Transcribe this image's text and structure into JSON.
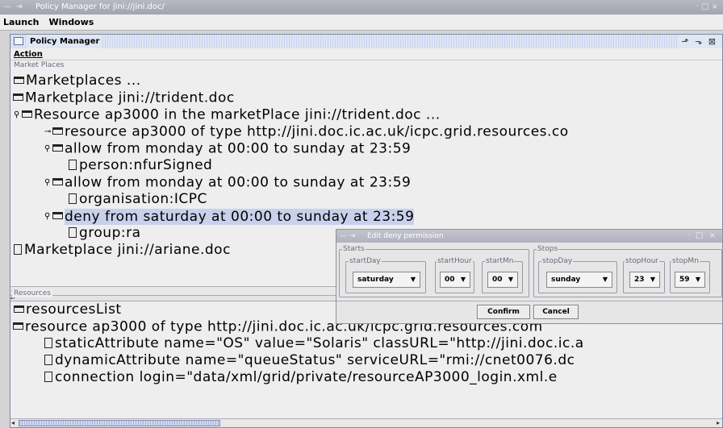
{
  "window": {
    "title": "Policy Manager for jini://jini.doc/",
    "wm_controls": "— ⇥",
    "buttons": "· □ ×"
  },
  "menubar": {
    "items": [
      "Launch",
      "Windows"
    ]
  },
  "internal_frame": {
    "title": "Policy Manager",
    "menu": "Action",
    "buttons": "⬏ ⬎ ⊠"
  },
  "market_places": {
    "label": "Market Places",
    "nodes": [
      {
        "text": "Marketplaces ...",
        "type": "folder",
        "handle": ""
      },
      {
        "text": "Marketplace jini://trident.doc",
        "type": "folder",
        "handle": "⚲"
      },
      {
        "text": "Resource ap3000 in the marketPlace jini://trident.doc ...",
        "type": "folder",
        "handle": "⚲"
      },
      {
        "text": "resource ap3000 of type http://jini.doc.ic.ac.uk/icpc.grid.resources.co",
        "type": "folder",
        "handle": "⊸"
      },
      {
        "text": "allow from monday at 00:00 to sunday at 23:59",
        "type": "folder",
        "handle": "⚲"
      },
      {
        "text": "person:nfurSigned",
        "type": "leaf",
        "handle": ""
      },
      {
        "text": "allow from monday at 00:00 to sunday at 23:59",
        "type": "folder",
        "handle": "⚲"
      },
      {
        "text": "organisation:ICPC",
        "type": "leaf",
        "handle": ""
      },
      {
        "text": "deny from saturday at 00:00 to sunday at 23:59",
        "type": "folder",
        "handle": "⚲",
        "selected": true
      },
      {
        "text": "group:ra",
        "type": "leaf",
        "handle": ""
      },
      {
        "text": "Marketplace jini://ariane.doc",
        "type": "leaf",
        "handle": ""
      }
    ]
  },
  "resources": {
    "label": "Resources",
    "nodes": [
      {
        "text": "resourcesList",
        "type": "folder",
        "handle": ""
      },
      {
        "text": "resource ap3000 of type http://jini.doc.ic.ac.uk/icpc.grid.resources.com",
        "type": "folder",
        "handle": "⚲"
      },
      {
        "text": "staticAttribute name=\"OS\" value=\"Solaris\" classURL=\"http://jini.doc.ic.a",
        "type": "leaf",
        "handle": ""
      },
      {
        "text": "dynamicAttribute name=\"queueStatus\" serviceURL=\"rmi://cnet0076.dc",
        "type": "leaf",
        "handle": ""
      },
      {
        "text": "connection login=\"data/xml/grid/private/resourceAP3000_login.xml.e",
        "type": "leaf",
        "handle": ""
      }
    ]
  },
  "dialog": {
    "title": "Edit deny permission",
    "wm_controls": "— ⇥",
    "buttons": "· □ ×",
    "starts": {
      "label": "Starts",
      "startDay": {
        "label": "startDay",
        "value": "saturday"
      },
      "startHour": {
        "label": "startHour",
        "value": "00"
      },
      "startMn": {
        "label": "startMn",
        "value": "00"
      }
    },
    "stops": {
      "label": "Stops",
      "stopDay": {
        "label": "stopDay",
        "value": "sunday"
      },
      "stopHour": {
        "label": "stopHour",
        "value": "23"
      },
      "stopMn": {
        "label": "stopMn",
        "value": "59"
      }
    },
    "confirm": "Confirm",
    "cancel": "Cancel"
  },
  "colors": {
    "selection": "#c8d0ec",
    "titlebar": "#a8a8b6",
    "frame_border": "#7a8aa8"
  },
  "icons": {
    "folder": "folder-icon",
    "leaf": "document-icon",
    "expand_handle": "expand-handle-icon",
    "dropdown": "chevron-down-icon"
  }
}
